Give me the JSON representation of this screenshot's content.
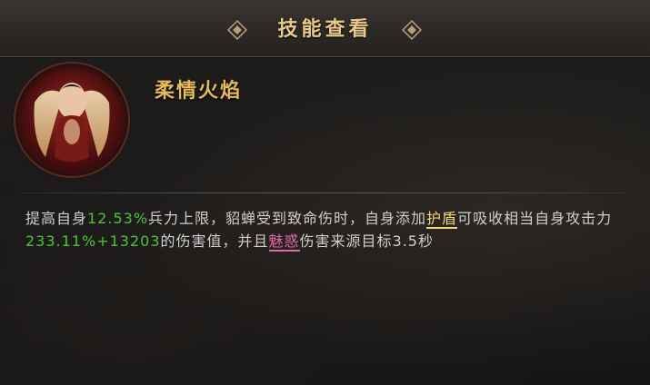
{
  "header": {
    "title": "技能查看"
  },
  "skill": {
    "name": "柔情火焰",
    "icon": "skill-portrait-icon",
    "description": {
      "p1": "提高自身",
      "v1": "12.53%",
      "p2": "兵力上限，貂蝉受到致命伤时，自身添加",
      "kw1": "护盾",
      "p3": "可吸收相当自身攻击力",
      "v2": "233.11%+13203",
      "p4": "的伤害值，并且",
      "kw2": "魅惑",
      "p5": "伤害来源目标3.5秒"
    }
  },
  "colors": {
    "title_gold": "#e8c98a",
    "skill_name_gold": "#e6b95c",
    "value_green": "#4ec23a",
    "shield_keyword": "#f0d27a",
    "charm_keyword": "#e06aa8"
  }
}
